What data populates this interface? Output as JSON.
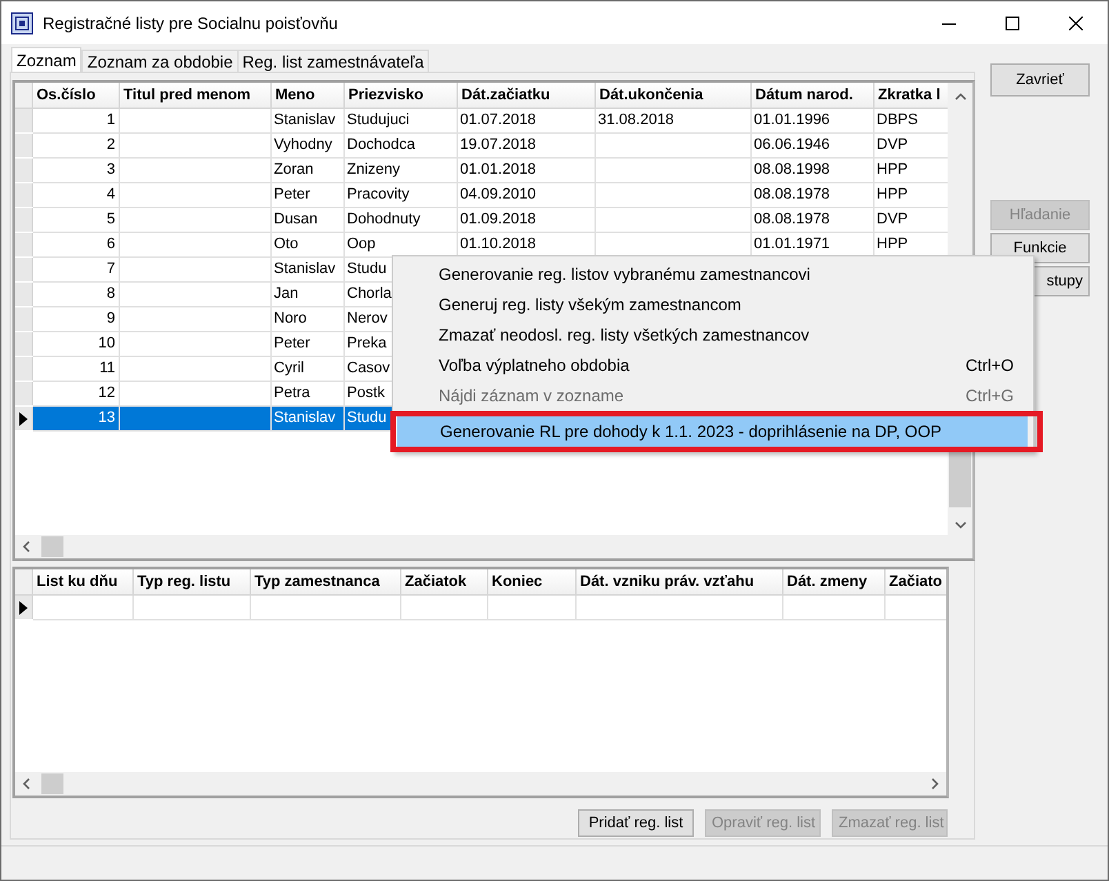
{
  "window": {
    "title": "Registračné listy pre Socialnu poisťovňu"
  },
  "tabs": [
    {
      "label": "Zoznam",
      "selected": true
    },
    {
      "label": "Zoznam za obdobie",
      "selected": false
    },
    {
      "label": "Reg. list zamestnávateľa",
      "selected": false
    }
  ],
  "employees_table": {
    "columns": [
      {
        "label": "Os.číslo"
      },
      {
        "label": "Titul pred menom"
      },
      {
        "label": "Meno"
      },
      {
        "label": "Priezvisko"
      },
      {
        "label": "Dát.začiatku"
      },
      {
        "label": "Dát.ukončenia"
      },
      {
        "label": "Dátum narod."
      },
      {
        "label": "Zkratka l"
      }
    ],
    "rows": [
      {
        "os_cislo": "1",
        "meno": "Stanislav",
        "priezvisko": "Studujuci",
        "zaciatok": "01.07.2018",
        "ukoncenie": "31.08.2018",
        "narodenie": "01.01.1996",
        "zkratka": "DBPS",
        "selected": false
      },
      {
        "os_cislo": "2",
        "meno": "Vyhodny",
        "priezvisko": "Dochodca",
        "zaciatok": "19.07.2018",
        "narodenie": "06.06.1946",
        "zkratka": "DVP",
        "selected": false
      },
      {
        "os_cislo": "3",
        "meno": "Zoran",
        "priezvisko": "Znizeny",
        "zaciatok": "01.01.2018",
        "narodenie": "08.08.1998",
        "zkratka": "HPP",
        "selected": false
      },
      {
        "os_cislo": "4",
        "meno": "Peter",
        "priezvisko": "Pracovity",
        "zaciatok": "04.09.2010",
        "narodenie": "08.08.1978",
        "zkratka": "HPP",
        "selected": false
      },
      {
        "os_cislo": "5",
        "meno": "Dusan",
        "priezvisko": "Dohodnuty",
        "zaciatok": "01.09.2018",
        "narodenie": "08.08.1978",
        "zkratka": "DVP",
        "selected": false
      },
      {
        "os_cislo": "6",
        "meno": "Oto",
        "priezvisko": "Oop",
        "zaciatok": "01.10.2018",
        "narodenie": "01.01.1971",
        "zkratka": "HPP",
        "selected": false
      },
      {
        "os_cislo": "7",
        "meno": "Stanislav",
        "priezvisko": "Studu",
        "selected": false
      },
      {
        "os_cislo": "8",
        "meno": "Jan",
        "priezvisko": "Chorla",
        "selected": false
      },
      {
        "os_cislo": "9",
        "meno": "Noro",
        "priezvisko": "Nerov",
        "selected": false
      },
      {
        "os_cislo": "10",
        "meno": "Peter",
        "priezvisko": "Preka",
        "selected": false
      },
      {
        "os_cislo": "11",
        "meno": "Cyril",
        "priezvisko": "Casov",
        "selected": false
      },
      {
        "os_cislo": "12",
        "meno": "Petra",
        "priezvisko": "Postk",
        "selected": false
      },
      {
        "os_cislo": "13",
        "meno": "Stanislav",
        "priezvisko": "Studu",
        "selected": true
      }
    ]
  },
  "context_menu": {
    "items": [
      {
        "label": "Generovanie reg. listov vybranému zamestnancovi",
        "disabled": false,
        "highlighted": false
      },
      {
        "label": "Generuj reg. listy všekým zamestnancom",
        "disabled": false,
        "highlighted": false
      },
      {
        "label": "Zmazať neodosl. reg. listy všetkých zamestnancov",
        "disabled": false,
        "highlighted": false
      },
      {
        "label": "Voľba výplatneho obdobia",
        "shortcut": "Ctrl+O",
        "disabled": false,
        "highlighted": false
      },
      {
        "label": "Nájdi záznam v zozname",
        "shortcut": "Ctrl+G",
        "disabled": true,
        "highlighted": false
      },
      {
        "label": "Generovanie RL pre dohody k 1.1. 2023 - doprihlásenie na DP, OOP",
        "disabled": false,
        "highlighted": true
      }
    ]
  },
  "side_buttons": [
    {
      "label": "Zavrieť",
      "disabled": false
    },
    {
      "label": "Hľadanie",
      "disabled": true
    },
    {
      "label": "Funkcie",
      "disabled": false
    },
    {
      "label": "stupy",
      "disabled": false
    }
  ],
  "register_table": {
    "columns": [
      {
        "label": "List ku dňu"
      },
      {
        "label": "Typ reg. listu"
      },
      {
        "label": "Typ zamestnanca"
      },
      {
        "label": "Začiatok"
      },
      {
        "label": "Koniec"
      },
      {
        "label": "Dát. vzniku práv. vzťahu"
      },
      {
        "label": "Dát. zmeny"
      },
      {
        "label": "Začiato"
      }
    ],
    "rows": [
      {
        "current": true
      }
    ]
  },
  "bottom_buttons": [
    {
      "label": "Pridať reg. list",
      "disabled": false
    },
    {
      "label": "Opraviť reg. list",
      "disabled": true
    },
    {
      "label": "Zmazať reg. list",
      "disabled": true
    }
  ]
}
